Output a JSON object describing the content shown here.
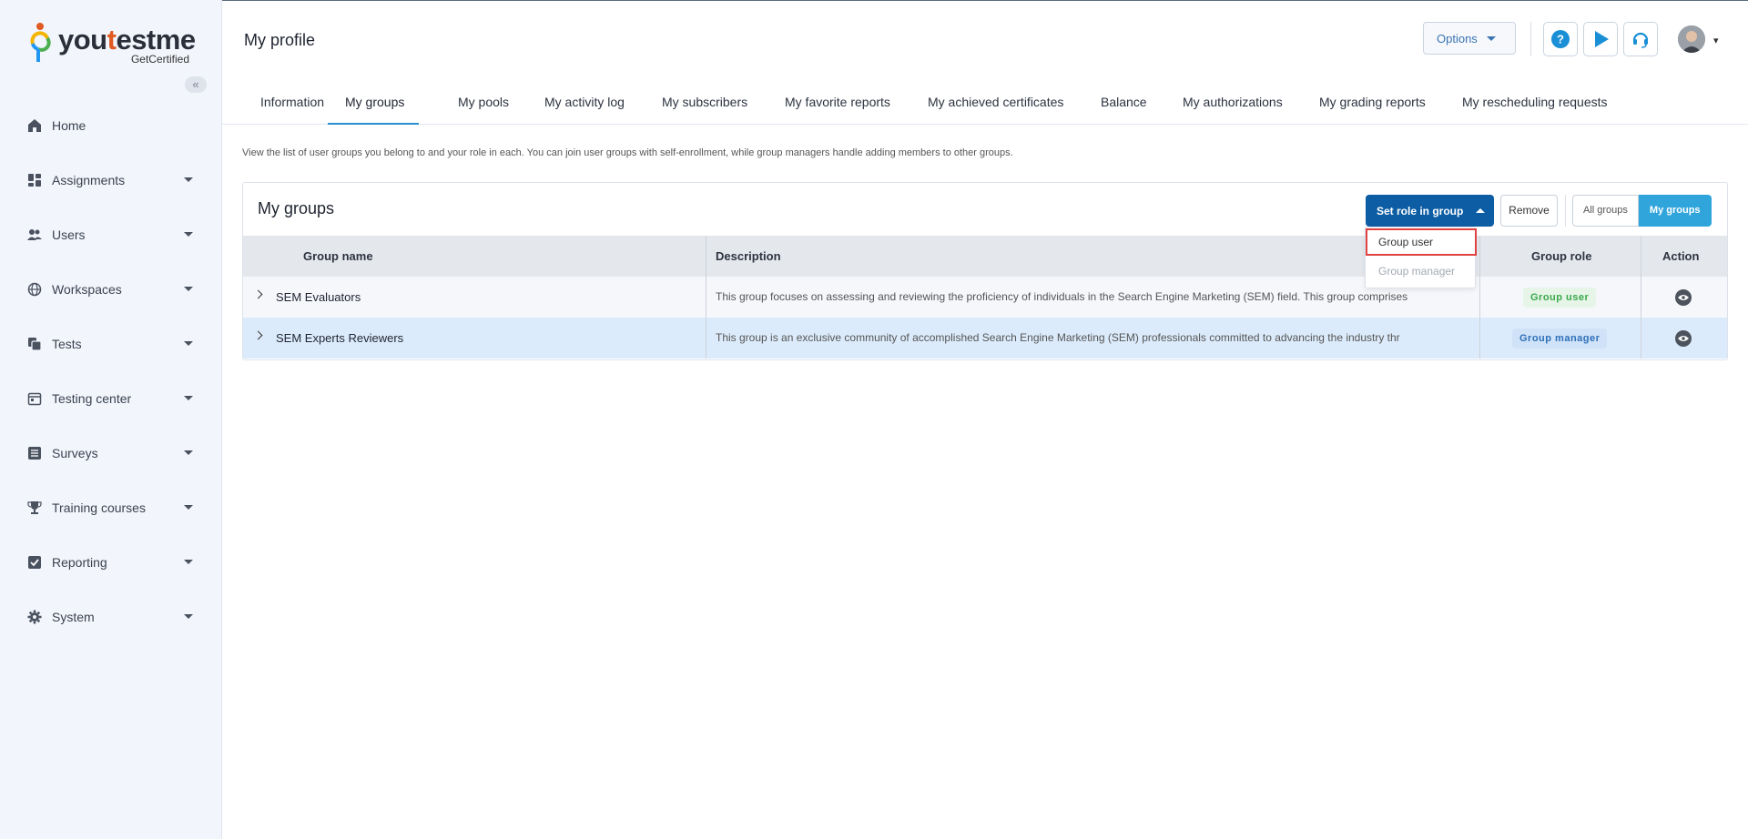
{
  "brand": {
    "logo_main": "youtestme",
    "logo_sub": "GetCertified",
    "colors": {
      "primary": "#0d5da4",
      "accent": "#30a5dc",
      "tab_underline": "#2a8fd0"
    }
  },
  "sidebar": {
    "collapse_icon": "double-chevron-left-icon",
    "items": [
      {
        "label": "Home",
        "icon": "home-icon"
      },
      {
        "label": "Assignments",
        "icon": "dashboard-icon"
      },
      {
        "label": "Users",
        "icon": "users-icon"
      },
      {
        "label": "Workspaces",
        "icon": "globe-icon"
      },
      {
        "label": "Tests",
        "icon": "copy-icon"
      },
      {
        "label": "Testing center",
        "icon": "calendar-icon"
      },
      {
        "label": "Surveys",
        "icon": "list-icon"
      },
      {
        "label": "Training courses",
        "icon": "trophy-icon"
      },
      {
        "label": "Reporting",
        "icon": "checkbox-icon"
      },
      {
        "label": "System",
        "icon": "gear-icon"
      }
    ]
  },
  "header": {
    "title": "My profile",
    "options_label": "Options"
  },
  "tabs": [
    "Information",
    "My groups",
    "My pools",
    "My activity log",
    "My subscribers",
    "My favorite reports",
    "My achieved certificates",
    "Balance",
    "My authorizations",
    "My grading reports",
    "My rescheduling requests"
  ],
  "active_tab": "My groups",
  "description": "View the list of user groups you belong to and your role in each. You can join user groups with self-enrollment, while group managers handle adding members to other groups.",
  "card": {
    "title": "My groups",
    "set_role_label": "Set role in group",
    "remove_label": "Remove",
    "all_groups_label": "All groups",
    "my_groups_label": "My groups"
  },
  "table": {
    "columns": [
      "Group name",
      "Description",
      "Group role",
      "Action"
    ],
    "rows": [
      {
        "name": "SEM Evaluators",
        "description": "This group focuses on assessing and reviewing the proficiency of individuals in the Search Engine Marketing (SEM) field. This group comprises",
        "role": "Group user"
      },
      {
        "name": "SEM Experts Reviewers",
        "description": "This group is an exclusive community of accomplished Search Engine Marketing (SEM) professionals committed to advancing the industry thr",
        "role": "Group manager"
      }
    ]
  },
  "dropdown": {
    "items": [
      "Group user",
      "Group manager"
    ],
    "highlighted": "Group user",
    "disabled": "Group manager"
  }
}
